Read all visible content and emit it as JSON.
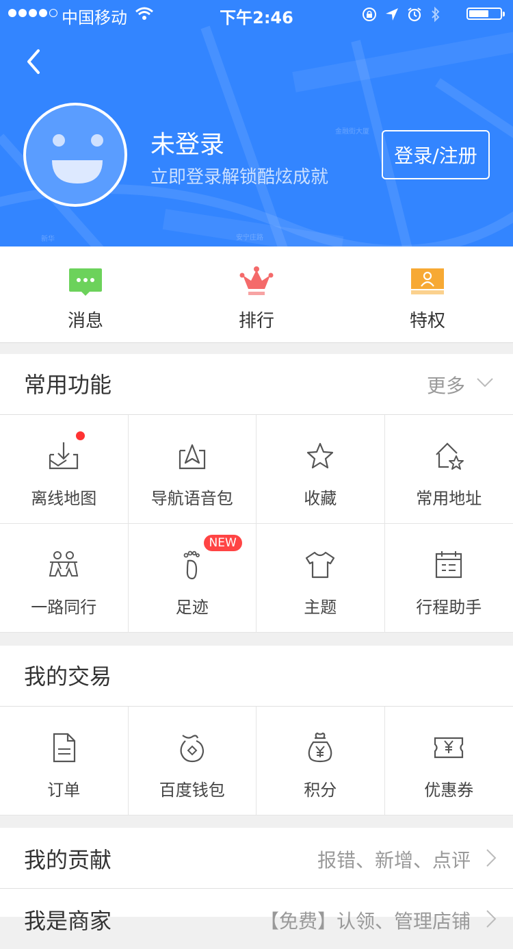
{
  "status_bar": {
    "carrier": "中国移动",
    "time": "下午2:46"
  },
  "header": {
    "username": "未登录",
    "subtitle": "立即登录解锁酷炫成就",
    "login_button": "登录/注册",
    "map_labels": [
      "金融街大厦",
      "新华",
      "安宁庄路"
    ]
  },
  "quick_actions": [
    {
      "label": "消息",
      "icon": "message-icon"
    },
    {
      "label": "排行",
      "icon": "crown-icon"
    },
    {
      "label": "特权",
      "icon": "privilege-card-icon"
    }
  ],
  "common_functions": {
    "title": "常用功能",
    "more": "更多",
    "items": [
      {
        "label": "离线地图",
        "icon": "offline-map-icon"
      },
      {
        "label": "导航语音包",
        "icon": "navigation-voice-icon"
      },
      {
        "label": "收藏",
        "icon": "star-icon"
      },
      {
        "label": "常用地址",
        "icon": "home-star-icon"
      },
      {
        "label": "一路同行",
        "icon": "companions-icon"
      },
      {
        "label": "足迹",
        "icon": "footprint-icon",
        "badge": "NEW"
      },
      {
        "label": "主题",
        "icon": "tshirt-icon"
      },
      {
        "label": "行程助手",
        "icon": "calendar-icon"
      }
    ]
  },
  "my_transactions": {
    "title": "我的交易",
    "items": [
      {
        "label": "订单",
        "icon": "document-icon"
      },
      {
        "label": "百度钱包",
        "icon": "wallet-icon"
      },
      {
        "label": "积分",
        "icon": "money-bag-icon"
      },
      {
        "label": "优惠券",
        "icon": "coupon-icon"
      }
    ]
  },
  "my_contribution": {
    "title": "我的贡献",
    "right": "报错、新增、点评"
  },
  "my_store": {
    "title": "我是商家",
    "right": "【免费】认领、管理店铺"
  }
}
